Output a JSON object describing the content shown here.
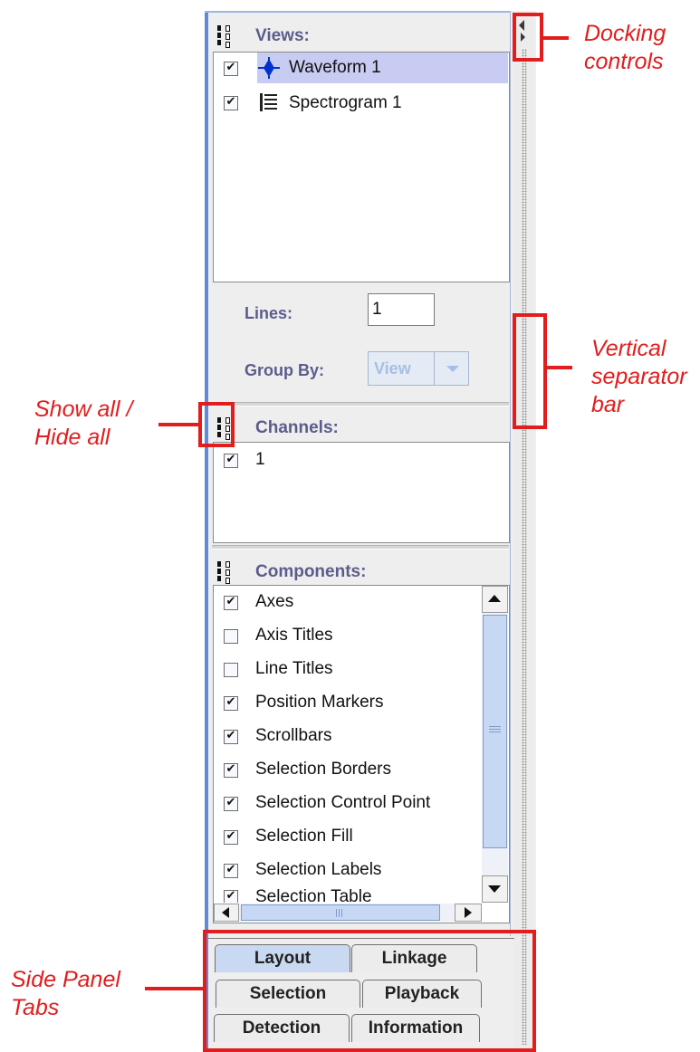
{
  "sections": {
    "views": {
      "title": "Views:",
      "items": [
        {
          "label": "Waveform 1",
          "checked": true,
          "selected": true,
          "icon": "waveform-icon"
        },
        {
          "label": "Spectrogram 1",
          "checked": true,
          "selected": false,
          "icon": "spectrogram-icon"
        }
      ],
      "lines_label": "Lines:",
      "lines_value": "1",
      "group_by_label": "Group By:",
      "group_by_value": "View"
    },
    "channels": {
      "title": "Channels:",
      "items": [
        {
          "label": "1",
          "checked": true
        }
      ]
    },
    "components": {
      "title": "Components:",
      "items": [
        {
          "label": "Axes",
          "checked": true
        },
        {
          "label": "Axis Titles",
          "checked": false
        },
        {
          "label": "Line Titles",
          "checked": false
        },
        {
          "label": "Position Markers",
          "checked": true
        },
        {
          "label": "Scrollbars",
          "checked": true
        },
        {
          "label": "Selection Borders",
          "checked": true
        },
        {
          "label": "Selection Control Point",
          "checked": true
        },
        {
          "label": "Selection Fill",
          "checked": true
        },
        {
          "label": "Selection Labels",
          "checked": true
        },
        {
          "label": "Selection Table",
          "checked": true
        }
      ]
    }
  },
  "tabs": {
    "layout": "Layout",
    "linkage": "Linkage",
    "selection": "Selection",
    "playback": "Playback",
    "detection": "Detection",
    "information": "Information",
    "active": "Layout"
  },
  "annotations": {
    "docking_line1": "Docking",
    "docking_line2": "controls",
    "separator_line1": "Vertical",
    "separator_line2": "separator",
    "separator_line3": "bar",
    "showall_line1": "Show all /",
    "showall_line2": "Hide all",
    "tabs_line1": "Side Panel",
    "tabs_line2": "Tabs"
  },
  "colors": {
    "annotation": "#e21d1d",
    "header_text": "#5c5c8c",
    "selected_row": "#c8cbf2",
    "active_tab": "#c9d9f1"
  }
}
